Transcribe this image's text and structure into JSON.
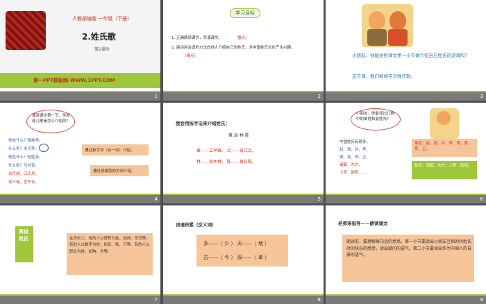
{
  "slides": [
    {
      "num": "1",
      "footer": "",
      "series": "人教部编版 一年级（下册）",
      "title": "2.姓氏歌",
      "subtitle": "第2课时",
      "banner": "第一PPT模板网-WWW.1PPT.COM"
    },
    {
      "num": "2",
      "footer": "",
      "badge": "学习目标",
      "goals": [
        "1. 正确朗读课文，背诵课文。",
        "2. 能运用合适的方法向他人介绍自己的姓氏，对中国姓氏文化产生兴趣。"
      ],
      "goal_tags": [
        "（重点）",
        "（难点）"
      ]
    },
    {
      "num": "3",
      "footer": "",
      "text1": "小朋友，你能仿照课文第一小节做介绍自己姓氏的游戏吗？",
      "text2": "这节课，我们继续学习姓氏歌。"
    },
    {
      "num": "4",
      "footer": "",
      "bubble": "诵读课文第一节，你发现儿歌是怎么介绍的？",
      "poem": [
        "你姓什么？我姓李。",
        "什么李？木子李。",
        "他姓什么？他姓张。",
        "什么张？弓长张。",
        "古月胡，口天吴，",
        "双人徐，言午许。"
      ],
      "note1": "通过拆字法（合一合）介绍。",
      "note2": "通过说偏旁的方法介绍。"
    },
    {
      "num": "5",
      "footer": "",
      "heading": "我会用拆字法来介绍姓氏：",
      "chars": "章 吕 林 陈",
      "rows": [
        "章——立早章。  吕——双口吕。",
        "林——双木林。  陈——耳东陈。"
      ]
    },
    {
      "num": "6",
      "footer": "",
      "bubble": "小朋友，你能找出儿歌中的单姓和复姓吗？",
      "poem": [
        "中国姓氏有很多，",
        "赵、钱、孙、李、",
        "周、吴、郑、王、",
        "诸葛、东方、",
        "上官、欧阳……"
      ],
      "note1": "单姓：赵、钱、孙、李、周、吴、郑、王。",
      "note2": "复姓：诸葛、东方、上官、欧阳。"
    },
    {
      "num": "7",
      "footer": "",
      "tag": "再说姓氏",
      "text": "在历史上，有的人以官职为姓，如帅、司马等。有的人以数字为姓，如伍、陆、万等。有的人以职业为姓，如陶、仓等。"
    },
    {
      "num": "8",
      "footer": "",
      "heading": "词语积累（反义词）",
      "rows": [
        "多——（ 少 ）  天——（ 地 ）",
        "古——（ 今 ）  双——（ 单 ）"
      ]
    },
    {
      "num": "9",
      "footer": "",
      "heading": "老师来指导——朗读课文",
      "text": "朗读前，要理解每句话的意思。第一小节要读出小朋友互相询问姓氏时的快乐的感受，读出疑问的语气。第二小节要读出作为中国人的自豪的语气。"
    }
  ],
  "colors": {
    "green": "#9ec73b",
    "orange": "#f6c59a",
    "red_title": "#c6261f"
  }
}
